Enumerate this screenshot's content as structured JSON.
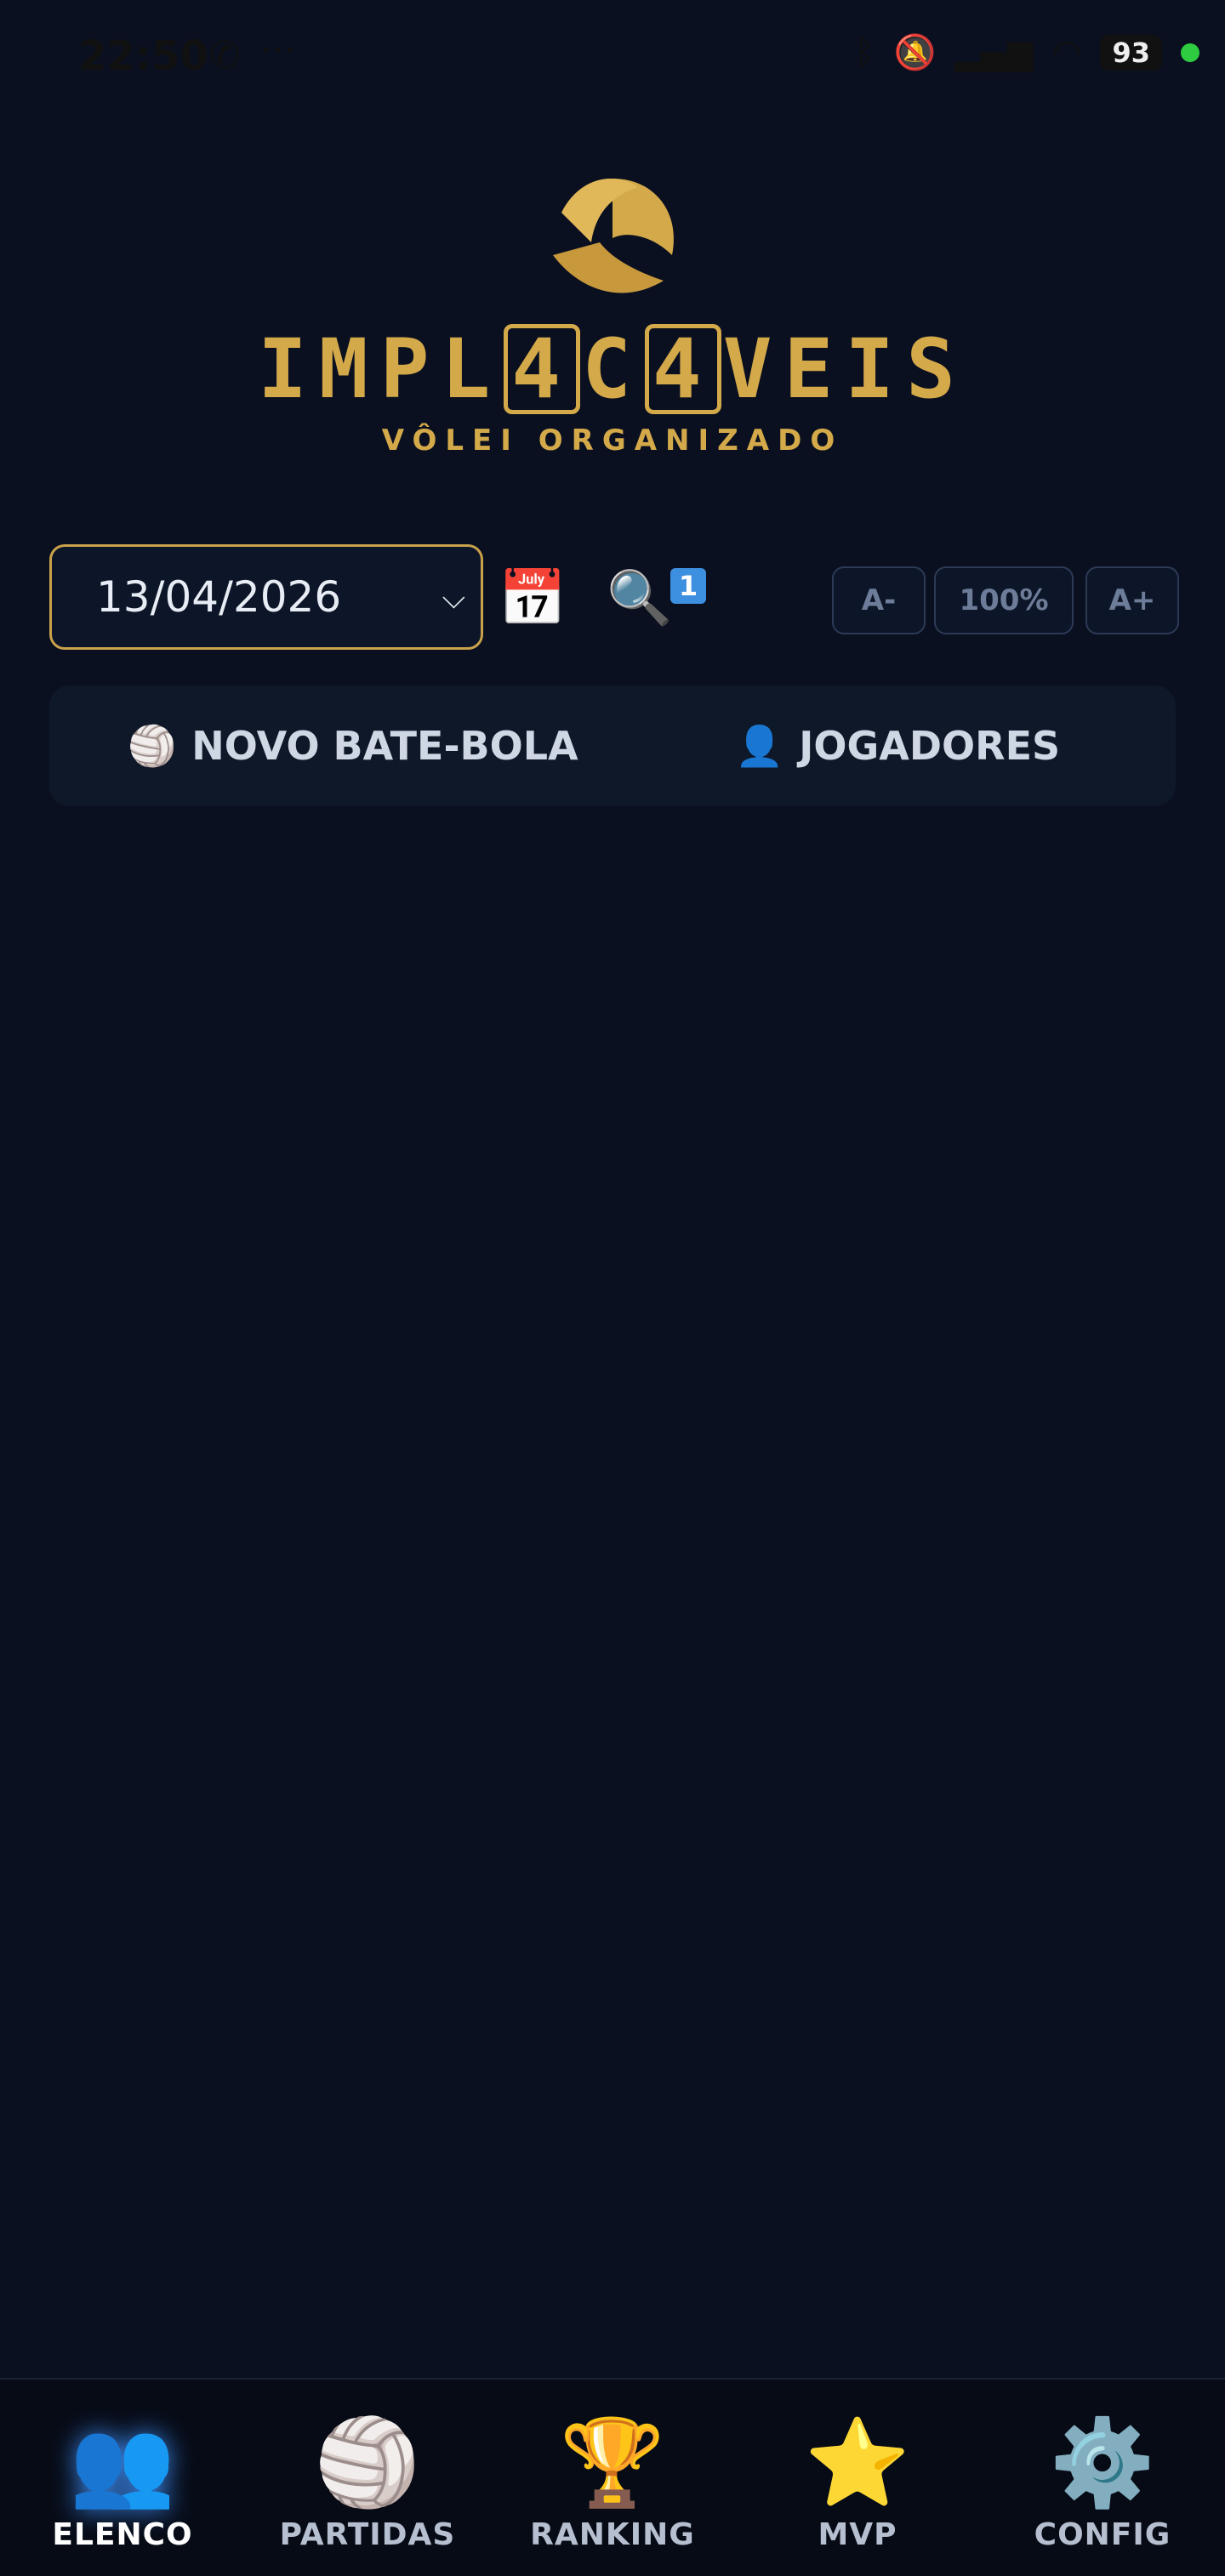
{
  "status_bar": {
    "time": "22:50",
    "whatsapp_icon": "whatsapp-icon",
    "more_glyph": "···",
    "battery": "93"
  },
  "brand": {
    "title_parts": [
      "IMPL",
      "4",
      "C",
      "4",
      "VEIS"
    ],
    "tagline": "VÔLEI ORGANIZADO",
    "accent_color": "#d4a94a"
  },
  "controls": {
    "date_value": "13/04/2026",
    "calendar_icon": "calendar-icon",
    "search_icon": "search-icon",
    "badge": "1",
    "zoom_out": "A-",
    "zoom_level": "100%",
    "zoom_in": "A+"
  },
  "tabs": [
    {
      "icon": "🏐",
      "label": "NOVO BATE-BOLA"
    },
    {
      "icon": "👤",
      "label": "JOGADORES"
    }
  ],
  "bottom_nav": [
    {
      "icon": "👥",
      "label": "ELENCO",
      "active": true
    },
    {
      "icon": "🏐",
      "label": "PARTIDAS"
    },
    {
      "icon": "🏆",
      "label": "RANKING"
    },
    {
      "icon": "⭐",
      "label": "MVP"
    },
    {
      "icon": "⚙️",
      "label": "CONFIG"
    }
  ],
  "colors": {
    "background": "#0a1020",
    "active_nav": "#3a86e8"
  }
}
